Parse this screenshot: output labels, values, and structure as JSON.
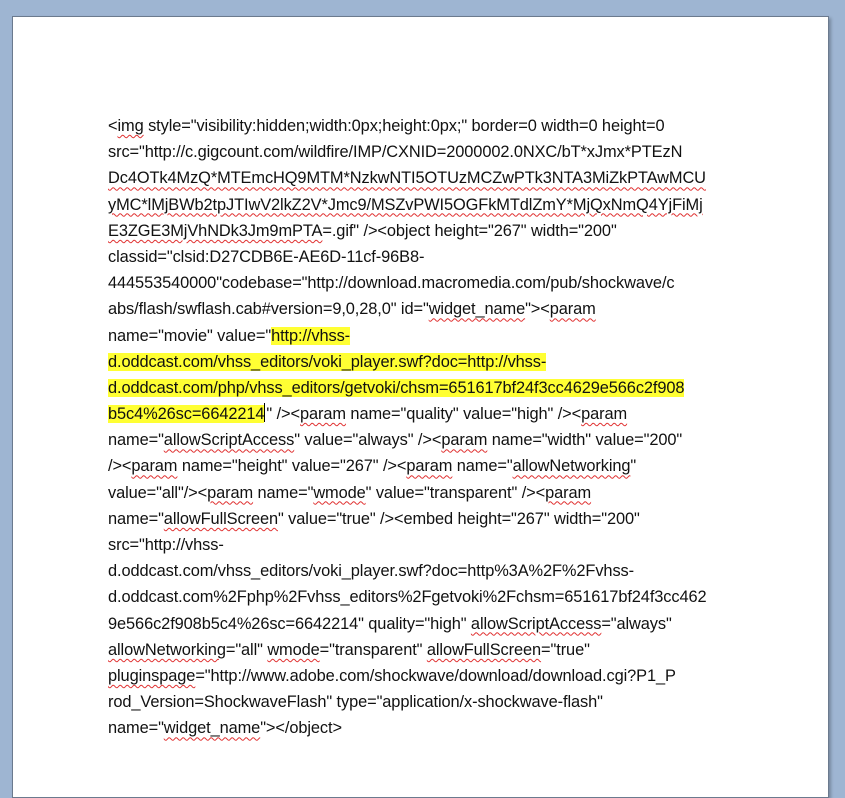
{
  "document": {
    "lines": [
      {
        "segs": [
          {
            "t": "<"
          },
          {
            "t": "img",
            "sq": true
          },
          {
            "t": " style=\"visibility:hidden;width:0px;height:0px;\" border=0 width=0 height=0"
          }
        ]
      },
      {
        "segs": [
          {
            "t": "src=\"http://c.gigcount.com/wildfire/IMP/CXNID=2000002.0NXC/bT*xJmx*PTEzN"
          }
        ]
      },
      {
        "segs": [
          {
            "t": "Dc4OTk4MzQ*MTEmcHQ9MTM*NzkwNTI5OTUzMCZwPTk3NTA3MiZkPTAwMCU",
            "sq": true
          }
        ]
      },
      {
        "segs": [
          {
            "t": "yMC*lMjBWb2tpJTIwV2lkZ2V*Jmc9/MSZvPWI5OGFkMTdlZmY*MjQxNmQ4YjFiMj",
            "sq": true
          }
        ]
      },
      {
        "segs": [
          {
            "t": "E3ZGE3MjVhNDk3Jm9mPTA",
            "sq": true
          },
          {
            "t": "=.gif\" /><object height=\"267\" width=\"200\""
          }
        ]
      },
      {
        "segs": [
          {
            "t": "classid=\"clsid:D27CDB6E-AE6D-11cf-96B8-"
          }
        ]
      },
      {
        "segs": [
          {
            "t": "444553540000\"codebase=\"http://download.macromedia.com/pub/shockwave/c"
          }
        ]
      },
      {
        "segs": [
          {
            "t": "abs/flash/swflash.cab#version=9,0,28,0\" id=\""
          },
          {
            "t": "widget_name",
            "sq": true
          },
          {
            "t": "\"><"
          },
          {
            "t": "param",
            "sq": true
          }
        ]
      },
      {
        "segs": [
          {
            "t": "name=\"movie\" value=\""
          },
          {
            "t": "http://vhss-",
            "hl": true
          }
        ]
      },
      {
        "segs": [
          {
            "t": "d.oddcast.com/vhss_editors/voki_player.swf?doc=http://vhss-",
            "hl": true
          }
        ]
      },
      {
        "segs": [
          {
            "t": "d.oddcast.com/php/vhss_editors/getvoki/chsm=651617bf24f3cc4629e566c2f908",
            "hl": true
          }
        ]
      },
      {
        "segs": [
          {
            "t": "b5c4%26sc=6642214",
            "hl": true
          },
          {
            "caret": true
          },
          {
            "t": "\" /><"
          },
          {
            "t": "param",
            "sq": true
          },
          {
            "t": " name=\"quality\" value=\"high\" /><"
          },
          {
            "t": "param",
            "sq": true
          }
        ]
      },
      {
        "segs": [
          {
            "t": "name=\""
          },
          {
            "t": "allowScriptAccess",
            "sq": true
          },
          {
            "t": "\" value=\"always\" /><"
          },
          {
            "t": "param",
            "sq": true
          },
          {
            "t": " name=\"width\" value=\"200\""
          }
        ]
      },
      {
        "segs": [
          {
            "t": "/><"
          },
          {
            "t": "param",
            "sq": true
          },
          {
            "t": " name=\"height\" value=\"267\" /><"
          },
          {
            "t": "param",
            "sq": true
          },
          {
            "t": " name=\""
          },
          {
            "t": "allowNetworking",
            "sq": true
          },
          {
            "t": "\""
          }
        ]
      },
      {
        "segs": [
          {
            "t": "value=\"all\"/><"
          },
          {
            "t": "param",
            "sq": true
          },
          {
            "t": " name=\""
          },
          {
            "t": "wmode",
            "sq": true
          },
          {
            "t": "\" value=\"transparent\" /><"
          },
          {
            "t": "param",
            "sq": true
          }
        ]
      },
      {
        "segs": [
          {
            "t": "name=\""
          },
          {
            "t": "allowFullScreen",
            "sq": true
          },
          {
            "t": "\" value=\"true\" /><embed height=\"267\" width=\"200\""
          }
        ]
      },
      {
        "segs": [
          {
            "t": "src=\"http://vhss-"
          }
        ]
      },
      {
        "segs": [
          {
            "t": "d.oddcast.com/vhss_editors/voki_player.swf?doc=http%3A%2F%2Fvhss-"
          }
        ]
      },
      {
        "segs": [
          {
            "t": "d.oddcast.com%2Fphp%2Fvhss_editors%2Fgetvoki%2Fchsm=651617bf24f3cc462"
          }
        ]
      },
      {
        "segs": [
          {
            "t": "9e566c2f908b5c4%26sc=6642214\" quality=\"high\" "
          },
          {
            "t": "allowScriptAccess",
            "sq": true
          },
          {
            "t": "=\"always\""
          }
        ]
      },
      {
        "segs": [
          {
            "t": "allowNetworking",
            "sq": true
          },
          {
            "t": "=\"all\" "
          },
          {
            "t": "wmode",
            "sq": true
          },
          {
            "t": "=\"transparent\" "
          },
          {
            "t": "allowFullScreen",
            "sq": true
          },
          {
            "t": "=\"true\""
          }
        ]
      },
      {
        "segs": [
          {
            "t": "pluginspage",
            "sq": true
          },
          {
            "t": "=\"http://www.adobe.com/shockwave/download/download.cgi?P1_P"
          }
        ]
      },
      {
        "segs": [
          {
            "t": "rod_Version=ShockwaveFlash\" type=\"application/x-shockwave-flash\""
          }
        ]
      },
      {
        "segs": [
          {
            "t": "name=\""
          },
          {
            "t": "widget_name",
            "sq": true
          },
          {
            "t": "\"></object>"
          }
        ]
      }
    ]
  },
  "colors": {
    "highlight": "#ffff33",
    "spellcheck": "#e03030",
    "workspace": "#9eb5d2"
  }
}
